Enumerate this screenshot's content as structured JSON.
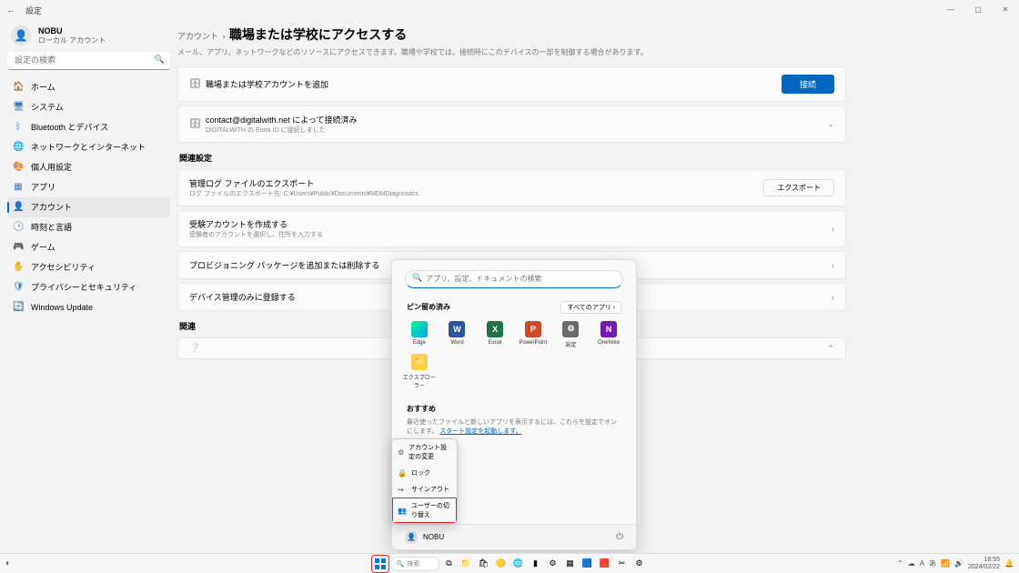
{
  "window": {
    "title": "設定"
  },
  "user": {
    "name": "NOBU",
    "role": "ローカル アカウント"
  },
  "search": {
    "placeholder": "設定の検索"
  },
  "nav": [
    {
      "icon": "🏠",
      "label": "ホーム",
      "color": "#e37400"
    },
    {
      "icon": "🖥",
      "label": "システム",
      "color": "#3a78c8"
    },
    {
      "icon": "ᛒ",
      "label": "Bluetooth とデバイス",
      "color": "#2d7cd6"
    },
    {
      "icon": "🌐",
      "label": "ネットワークとインターネット",
      "color": "#2d7cd6"
    },
    {
      "icon": "🎨",
      "label": "個人用設定",
      "color": "#8a6d3b"
    },
    {
      "icon": "▦",
      "label": "アプリ",
      "color": "#3a78c8"
    },
    {
      "icon": "👤",
      "label": "アカウント",
      "color": "#b35d00"
    },
    {
      "icon": "🕒",
      "label": "時刻と言語",
      "color": "#d27a00"
    },
    {
      "icon": "🎮",
      "label": "ゲーム",
      "color": "#0ea15f"
    },
    {
      "icon": "✋",
      "label": "アクセシビリティ",
      "color": "#0078d4"
    },
    {
      "icon": "🛡",
      "label": "プライバシーとセキュリティ",
      "color": "#3a78c8"
    },
    {
      "icon": "🔄",
      "label": "Windows Update",
      "color": "#0078d4"
    }
  ],
  "page": {
    "crumb_parent": "アカウント",
    "title": "職場または学校にアクセスする",
    "subtitle": "メール、アプリ、ネットワークなどのリソースにアクセスできます。職場や学校では、接続時にこのデバイスの一部を制御する場合があります。",
    "add_card": {
      "title": "職場または学校アカウントを追加",
      "btn": "接続"
    },
    "connected": {
      "title": "contact@digitalwith.net によって接続済み",
      "sub": "DIGITALWITH の Entra ID に接続しました"
    },
    "related_h": "関連設定",
    "cards": [
      {
        "title": "管理ログ ファイルのエクスポート",
        "sub": "ログ ファイルのエクスポート先: C:¥Users¥Public¥Documents¥MDMDiagnostics",
        "btn": "エクスポート"
      },
      {
        "title": "受験アカウントを作成する",
        "sub": "受験者のアカウントを選択し、住所を入力する",
        "chev": "›"
      },
      {
        "title": "プロビジョニング パッケージを追加または削除する",
        "chev": "›"
      },
      {
        "title": "デバイス管理のみに登録する",
        "chev": "›"
      }
    ],
    "related2_h": "関連"
  },
  "start": {
    "search_ph": "アプリ、設定、ドキュメントの検索",
    "pinned_h": "ピン留め済み",
    "all_apps": "すべてのアプリ  ›",
    "tiles": [
      {
        "label": "Edge",
        "cls": "c-edge",
        "ch": ""
      },
      {
        "label": "Word",
        "cls": "c-word",
        "ch": "W"
      },
      {
        "label": "Excel",
        "cls": "c-excel",
        "ch": "X"
      },
      {
        "label": "PowerPoint",
        "cls": "c-ppt",
        "ch": "P"
      },
      {
        "label": "設定",
        "cls": "c-set",
        "ch": "⚙"
      },
      {
        "label": "OneNote",
        "cls": "c-on",
        "ch": "N"
      },
      {
        "label": "エクスプローラー",
        "cls": "c-exp",
        "ch": "📁"
      }
    ],
    "rec_h": "おすすめ",
    "rec_txt": "最近使ったファイルと新しいアプリを表示するには、これらを設定でオンにします。",
    "rec_link": "スタート設定を起動します。",
    "user": "NOBU"
  },
  "umenu": [
    {
      "icon": "⚙",
      "label": "アカウント設定の変更"
    },
    {
      "icon": "🔒",
      "label": "ロック"
    },
    {
      "icon": "↪",
      "label": "サインアウト"
    },
    {
      "icon": "👥",
      "label": "ユーザーの切り替え",
      "hl": true
    }
  ],
  "taskbar": {
    "search": "検索",
    "time": "18:55",
    "date": "2024/02/22"
  }
}
